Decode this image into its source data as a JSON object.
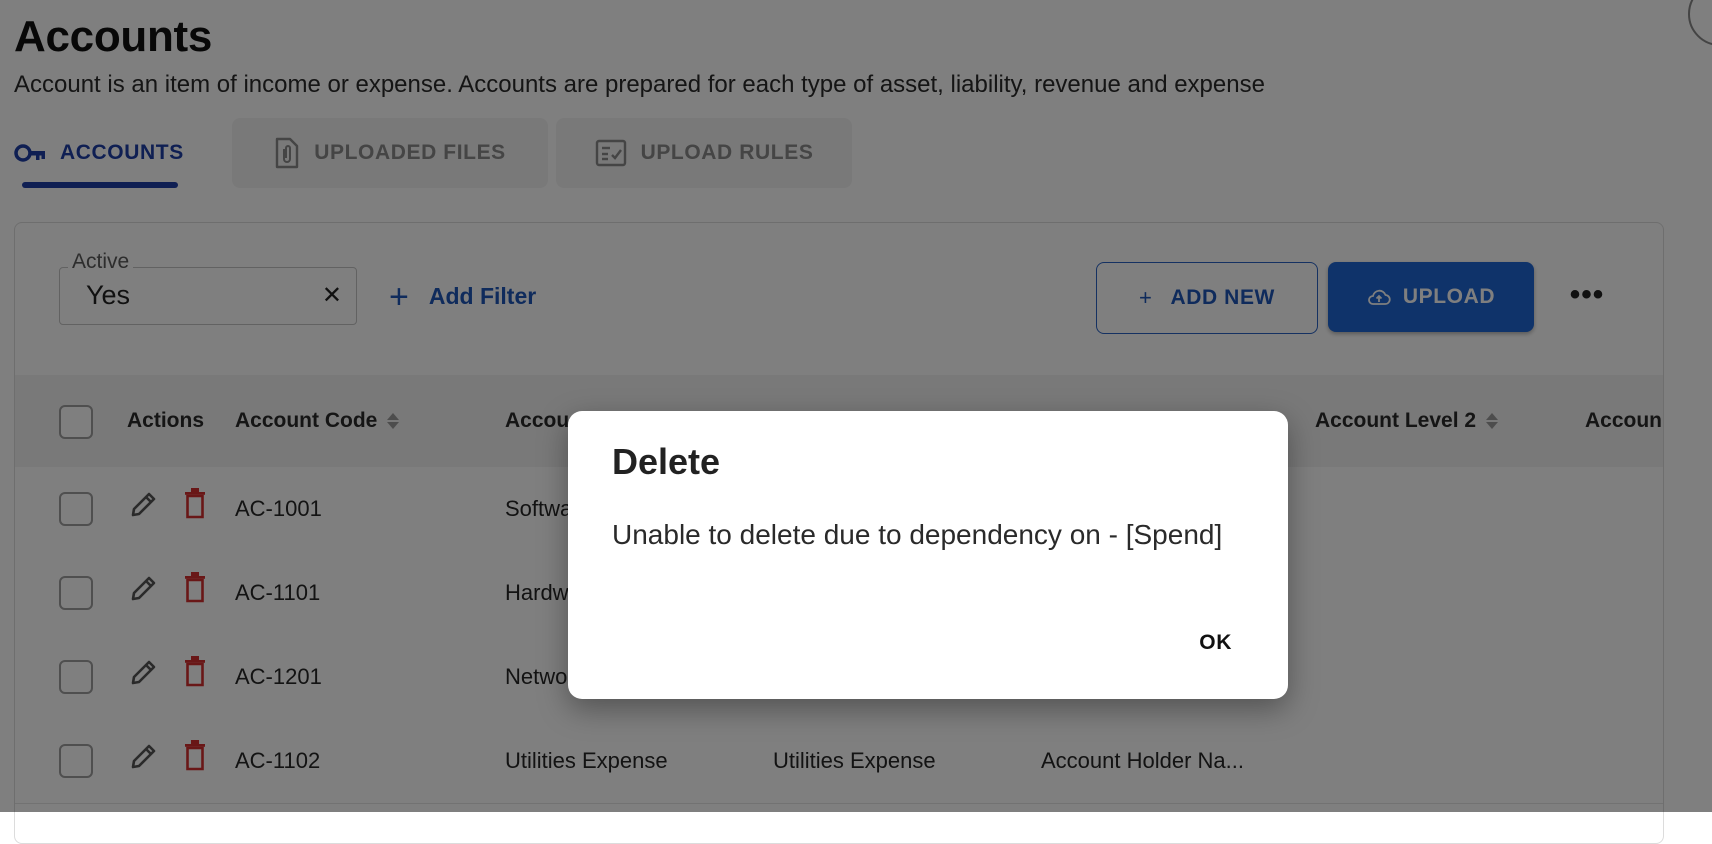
{
  "header": {
    "title": "Accounts",
    "subtitle": "Account is an item of income or expense. Accounts are prepared for each type of asset, liability, revenue and expense"
  },
  "tabs": [
    {
      "label": "ACCOUNTS",
      "icon": "key-icon",
      "active": true
    },
    {
      "label": "UPLOADED FILES",
      "icon": "file-attachment-icon",
      "active": false
    },
    {
      "label": "UPLOAD RULES",
      "icon": "checklist-icon",
      "active": false
    }
  ],
  "filter": {
    "label": "Active",
    "value": "Yes"
  },
  "toolbar": {
    "add_filter": "Add Filter",
    "add_new": "ADD NEW",
    "upload": "UPLOAD"
  },
  "table": {
    "columns": [
      "Actions",
      "Account Code",
      "Accou",
      "Account Level 2",
      "Accoun"
    ],
    "rows": [
      {
        "code": "AC-1001",
        "name": "Softwa",
        "col3": "",
        "col4": ""
      },
      {
        "code": "AC-1101",
        "name": "Hardw",
        "col3": "",
        "col4": ""
      },
      {
        "code": "AC-1201",
        "name": "Netwo",
        "col3": "",
        "col4": ""
      },
      {
        "code": "AC-1102",
        "name": "Utilities Expense",
        "col3": "Utilities Expense",
        "col4": "Account Holder Na..."
      }
    ]
  },
  "dialog": {
    "title": "Delete",
    "message": "Unable to delete due to dependency on - [Spend]",
    "ok": "OK"
  },
  "colors": {
    "primary": "#1f66d4",
    "tab_active": "#1f3fa6",
    "delete_icon": "#d32f2f"
  }
}
